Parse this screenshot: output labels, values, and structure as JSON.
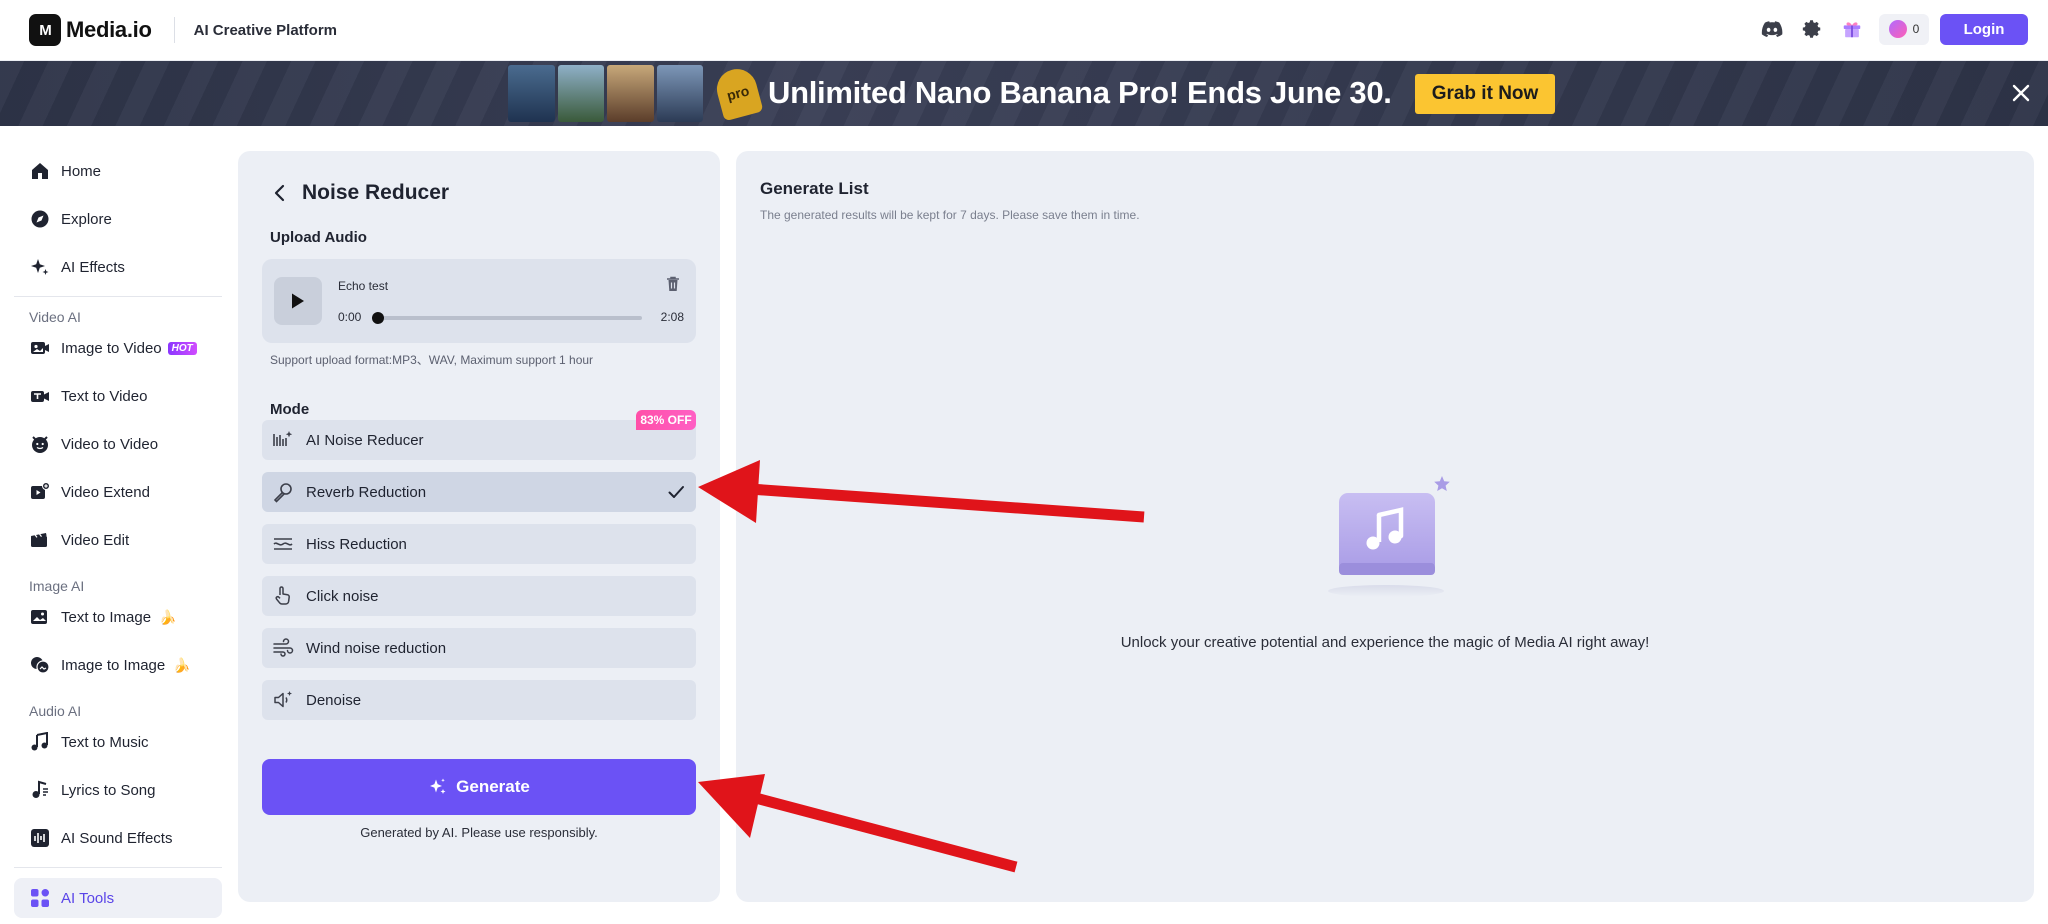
{
  "header": {
    "logo_mark": "M",
    "logo_text": "Media.io",
    "platform": "AI Creative Platform",
    "credits": "0",
    "login_label": "Login"
  },
  "banner": {
    "pro_label": "pro",
    "text": "Unlimited Nano Banana Pro! Ends June 30.",
    "cta_label": "Grab it Now"
  },
  "sidebar": {
    "items_top": [
      {
        "label": "Home",
        "icon": "home-icon"
      },
      {
        "label": "Explore",
        "icon": "compass-icon"
      },
      {
        "label": "AI Effects",
        "icon": "sparkle-icon"
      }
    ],
    "sections": {
      "video": "Video AI",
      "image": "Image AI",
      "audio": "Audio AI"
    },
    "video_items": [
      {
        "label": "Image to Video",
        "badge": "HOT"
      },
      {
        "label": "Text to Video"
      },
      {
        "label": "Video to Video"
      },
      {
        "label": "Video Extend"
      },
      {
        "label": "Video Edit"
      }
    ],
    "image_items": [
      {
        "label": "Text to Image",
        "emoji": "🍌"
      },
      {
        "label": "Image to Image",
        "emoji": "🍌"
      }
    ],
    "audio_items": [
      {
        "label": "Text to Music"
      },
      {
        "label": "Lyrics to Song"
      },
      {
        "label": "AI Sound Effects"
      }
    ],
    "tools_label": "AI Tools"
  },
  "tool": {
    "title": "Noise Reducer",
    "upload_label": "Upload Audio",
    "audio": {
      "name": "Echo test",
      "current": "0:00",
      "duration": "2:08",
      "progress": 0
    },
    "support_text": "Support upload format:MP3、WAV, Maximum support 1 hour",
    "mode_label": "Mode",
    "offer_badge": "83% OFF",
    "modes": [
      {
        "label": "AI Noise Reducer",
        "icon": "waveform-sparkle-icon",
        "selected": false
      },
      {
        "label": "Reverb Reduction",
        "icon": "microphone-icon",
        "selected": true
      },
      {
        "label": "Hiss Reduction",
        "icon": "sliders-icon",
        "selected": false
      },
      {
        "label": "Click noise",
        "icon": "hand-pointer-icon",
        "selected": false
      },
      {
        "label": "Wind noise reduction",
        "icon": "wind-icon",
        "selected": false
      },
      {
        "label": "Denoise",
        "icon": "speaker-icon",
        "selected": false
      }
    ],
    "generate_label": "Generate",
    "disclaimer": "Generated by AI. Please use responsibly."
  },
  "generate_list": {
    "title": "Generate List",
    "subtitle": "The generated results will be kept for 7 days. Please save them in time.",
    "empty_message": "Unlock your creative potential and experience the magic of Media AI right away!"
  },
  "colors": {
    "accent": "#6b52f5",
    "banner_cta": "#fbc531",
    "annotation": "#e0141a",
    "panel_bg": "#eceff5"
  }
}
